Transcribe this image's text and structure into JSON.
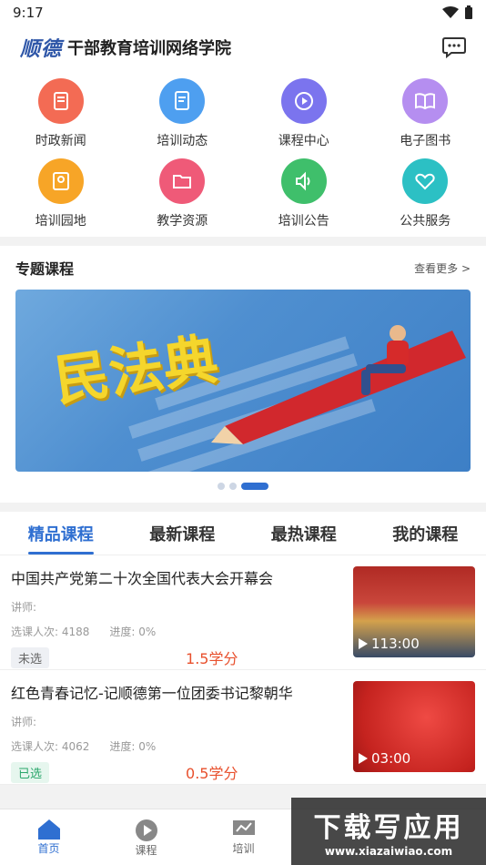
{
  "status": {
    "time": "9:17"
  },
  "header": {
    "logo": "顺德",
    "title": "干部教育培训网络学院"
  },
  "grid": [
    {
      "label": "时政新闻",
      "icon": "news-icon",
      "color": "#f36b54"
    },
    {
      "label": "培训动态",
      "icon": "document-icon",
      "color": "#4e9ff0"
    },
    {
      "label": "课程中心",
      "icon": "play-circle-icon",
      "color": "#7b74ee"
    },
    {
      "label": "电子图书",
      "icon": "book-icon",
      "color": "#b58ef0"
    },
    {
      "label": "培训园地",
      "icon": "garden-icon",
      "color": "#f7a527"
    },
    {
      "label": "教学资源",
      "icon": "folder-icon",
      "color": "#ef5a78"
    },
    {
      "label": "培训公告",
      "icon": "speaker-icon",
      "color": "#3fbf6b"
    },
    {
      "label": "公共服务",
      "icon": "handshake-icon",
      "color": "#2cc0c4"
    }
  ],
  "featured": {
    "title": "专题课程",
    "more": "查看更多 >",
    "banner_text": "民法典"
  },
  "tabs": [
    "精品课程",
    "最新课程",
    "最热课程",
    "我的课程"
  ],
  "courses": [
    {
      "title": "中国共产党第二十次全国代表大会开幕会",
      "lecturer": "讲师:",
      "enrolled": "选课人次:  4188",
      "progress": "进度:  0%",
      "status": "未选",
      "credit": "1.5学分",
      "duration": "113:00"
    },
    {
      "title": "红色青春记忆-记顺德第一位团委书记黎朝华",
      "lecturer": "讲师:",
      "enrolled": "选课人次:  4062",
      "progress": "进度:  0%",
      "status": "已选",
      "credit": "0.5学分",
      "duration": "03:00"
    }
  ],
  "tabbar": [
    {
      "label": "首页",
      "icon": "home-icon"
    },
    {
      "label": "课程",
      "icon": "play-icon"
    },
    {
      "label": "培训",
      "icon": "training-icon"
    }
  ],
  "watermark": {
    "line1": "下载写应用",
    "line2": "www.xiazaiwiao.com"
  }
}
